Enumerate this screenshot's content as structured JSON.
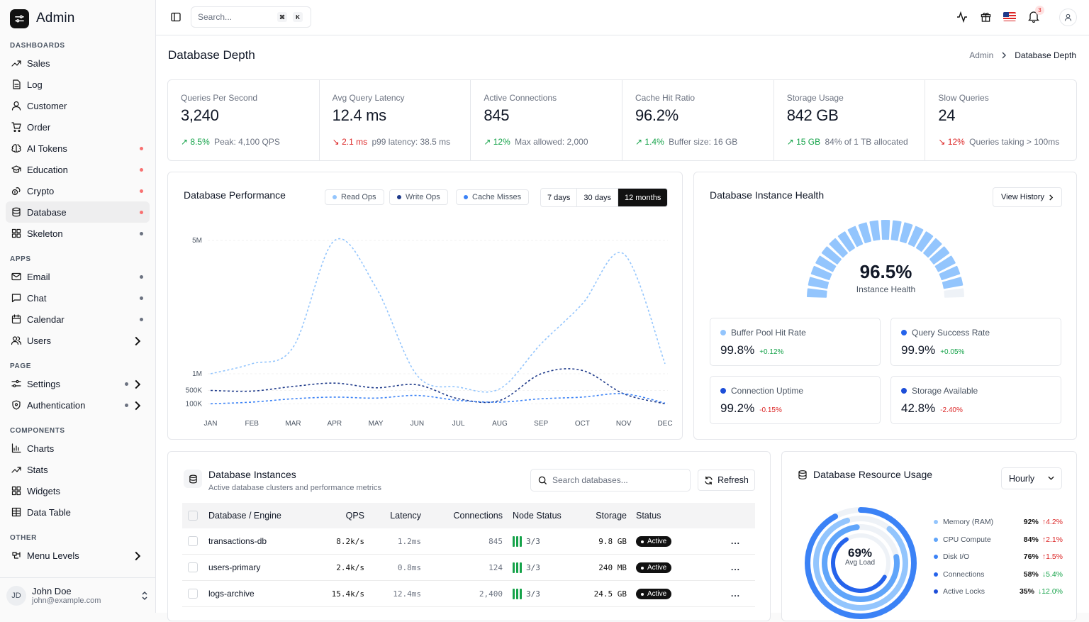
{
  "brand": {
    "name": "Admin"
  },
  "sidebar": {
    "sections": [
      {
        "title": "DASHBOARDS",
        "items": [
          {
            "label": "Sales",
            "icon": "trending-up-icon"
          },
          {
            "label": "Log",
            "icon": "file-text-icon"
          },
          {
            "label": "Customer",
            "icon": "user-icon"
          },
          {
            "label": "Order",
            "icon": "cart-icon"
          },
          {
            "label": "AI Tokens",
            "icon": "brain-icon",
            "dot": "red"
          },
          {
            "label": "Education",
            "icon": "graduation-cap-icon",
            "dot": "red"
          },
          {
            "label": "Crypto",
            "icon": "coins-icon",
            "dot": "red"
          },
          {
            "label": "Database",
            "icon": "database-icon",
            "dot": "red",
            "active": true
          },
          {
            "label": "Skeleton",
            "icon": "grid-icon",
            "dot": "gray"
          }
        ]
      },
      {
        "title": "APPS",
        "items": [
          {
            "label": "Email",
            "icon": "mail-icon",
            "dot": "gray"
          },
          {
            "label": "Chat",
            "icon": "message-square-icon",
            "dot": "gray"
          },
          {
            "label": "Calendar",
            "icon": "calendar-icon",
            "dot": "gray"
          },
          {
            "label": "Users",
            "icon": "users-icon",
            "chevron": true
          }
        ]
      },
      {
        "title": "PAGE",
        "items": [
          {
            "label": "Settings",
            "icon": "sliders-icon",
            "dot": "gray",
            "chevron": true
          },
          {
            "label": "Authentication",
            "icon": "shield-icon",
            "dot": "gray",
            "chevron": true
          }
        ]
      },
      {
        "title": "COMPONENTS",
        "items": [
          {
            "label": "Charts",
            "icon": "bar-chart-icon"
          },
          {
            "label": "Stats",
            "icon": "trending-up-icon"
          },
          {
            "label": "Widgets",
            "icon": "grid-icon"
          },
          {
            "label": "Data Table",
            "icon": "table-icon"
          }
        ]
      },
      {
        "title": "OTHER",
        "items": [
          {
            "label": "Menu Levels",
            "icon": "layers-icon",
            "chevron": true
          }
        ]
      }
    ],
    "user": {
      "initials": "JD",
      "name": "John Doe",
      "email": "john@example.com"
    }
  },
  "topbar": {
    "search_placeholder": "Search...",
    "kbd": [
      "⌘",
      "K"
    ],
    "notification_count": "3"
  },
  "page": {
    "title": "Database Depth",
    "breadcrumb": [
      "Admin",
      "Database Depth"
    ]
  },
  "stats": [
    {
      "label": "Queries Per Second",
      "value": "3,240",
      "change": "8.5%",
      "trend": "up",
      "note": "Peak: 4,100 QPS"
    },
    {
      "label": "Avg Query Latency",
      "value": "12.4 ms",
      "change": "2.1 ms",
      "trend": "down",
      "note": "p99 latency: 38.5 ms"
    },
    {
      "label": "Active Connections",
      "value": "845",
      "change": "12%",
      "trend": "up",
      "note": "Max allowed: 2,000"
    },
    {
      "label": "Cache Hit Ratio",
      "value": "96.2%",
      "change": "1.4%",
      "trend": "up",
      "note": "Buffer size: 16 GB"
    },
    {
      "label": "Storage Usage",
      "value": "842 GB",
      "change": "15 GB",
      "trend": "up",
      "note": "84% of 1 TB allocated"
    },
    {
      "label": "Slow Queries",
      "value": "24",
      "change": "12%",
      "trend": "down",
      "note": "Queries taking > 100ms"
    }
  ],
  "performance": {
    "title": "Database Performance",
    "legend": [
      {
        "label": "Read Ops",
        "color": "#93c5fd"
      },
      {
        "label": "Write Ops",
        "color": "#1e3a8a"
      },
      {
        "label": "Cache Misses",
        "color": "#3b82f6"
      }
    ],
    "ranges": [
      "7 days",
      "30 days",
      "12 months"
    ],
    "active_range": "12 months"
  },
  "chart_data": {
    "type": "line",
    "categories": [
      "JAN",
      "FEB",
      "MAR",
      "APR",
      "MAY",
      "JUN",
      "JUL",
      "AUG",
      "SEP",
      "OCT",
      "NOV",
      "DEC"
    ],
    "y_tick_labels": [
      "100K",
      "500K",
      "1M",
      "5M"
    ],
    "series": [
      {
        "name": "Read Ops",
        "color": "#93c5fd",
        "values": [
          1.0,
          1.3,
          1.8,
          5.0,
          3.6,
          0.95,
          0.6,
          0.55,
          1.9,
          3.1,
          4.6,
          1.3
        ]
      },
      {
        "name": "Write Ops",
        "color": "#1e3a8a",
        "values": [
          0.5,
          0.48,
          0.62,
          0.72,
          0.58,
          0.67,
          0.25,
          0.2,
          1.0,
          1.1,
          0.4,
          0.1
        ]
      },
      {
        "name": "Cache Misses",
        "color": "#3b82f6",
        "values": [
          0.1,
          0.15,
          0.25,
          0.3,
          0.27,
          0.35,
          0.2,
          0.15,
          0.25,
          0.3,
          0.4,
          0.12
        ]
      }
    ],
    "ylim": [
      0,
      5.3
    ]
  },
  "health": {
    "title": "Database Instance Health",
    "view_history": "View History",
    "gauge_value": "96.5%",
    "gauge_percent": 96.5,
    "gauge_label": "Instance Health",
    "metrics": [
      {
        "label": "Buffer Pool Hit Rate",
        "value": "99.8%",
        "change": "+0.12%",
        "trend": "up",
        "color": "#93c5fd"
      },
      {
        "label": "Query Success Rate",
        "value": "99.9%",
        "change": "+0.05%",
        "trend": "up",
        "color": "#2563eb"
      },
      {
        "label": "Connection Uptime",
        "value": "99.2%",
        "change": "-0.15%",
        "trend": "down",
        "color": "#1d4ed8"
      },
      {
        "label": "Storage Available",
        "value": "42.8%",
        "change": "-2.40%",
        "trend": "down",
        "color": "#1d4ed8"
      }
    ]
  },
  "instances": {
    "title": "Database Instances",
    "subtitle": "Active database clusters and performance metrics",
    "search_placeholder": "Search databases...",
    "refresh": "Refresh",
    "columns": [
      "Database / Engine",
      "QPS",
      "Latency",
      "Connections",
      "Node Status",
      "Storage",
      "Status"
    ],
    "rows": [
      {
        "name": "transactions-db",
        "qps": "8.2k/s",
        "latency": "1.2ms",
        "connections": "845",
        "nodes": "3/3",
        "storage": "9.8 GB",
        "status": "Active"
      },
      {
        "name": "users-primary",
        "qps": "2.4k/s",
        "latency": "0.8ms",
        "connections": "124",
        "nodes": "3/3",
        "storage": "240 MB",
        "status": "Active"
      },
      {
        "name": "logs-archive",
        "qps": "15.4k/s",
        "latency": "12.4ms",
        "connections": "2,400",
        "nodes": "3/3",
        "storage": "24.5 GB",
        "status": "Active"
      }
    ],
    "more": "..."
  },
  "resources": {
    "title": "Database Resource Usage",
    "select": "Hourly",
    "center_value": "69%",
    "center_label": "Avg Load",
    "items": [
      {
        "label": "Memory (RAM)",
        "pct": "92%",
        "change": "4.2%",
        "trend": "up",
        "color": "#93c5fd",
        "value": 92
      },
      {
        "label": "CPU Compute",
        "pct": "84%",
        "change": "2.1%",
        "trend": "up",
        "color": "#60a5fa",
        "value": 84
      },
      {
        "label": "Disk I/O",
        "pct": "76%",
        "change": "1.5%",
        "trend": "up",
        "color": "#3b82f6",
        "value": 76
      },
      {
        "label": "Connections",
        "pct": "58%",
        "change": "5.4%",
        "trend": "down",
        "color": "#2563eb",
        "value": 58
      },
      {
        "label": "Active Locks",
        "pct": "35%",
        "change": "12.0%",
        "trend": "down",
        "color": "#1d4ed8",
        "value": 35
      }
    ]
  }
}
